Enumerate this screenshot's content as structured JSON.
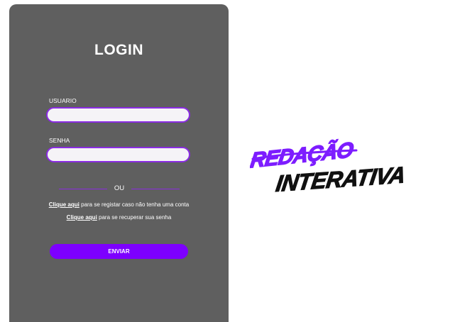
{
  "login": {
    "title": "LOGIN",
    "username_label": "USUARIO",
    "username_value": "",
    "password_label": "SENHA",
    "password_value": "",
    "divider_text": "OU",
    "register_link": "Clique aqui",
    "register_text": " para se registar caso não tenha uma conta",
    "recover_link": "Clique aqui",
    "recover_text": " para se recuperar sua senha",
    "submit_label": "ENVIAR"
  },
  "logo": {
    "line1": "REDAÇÃO",
    "line2": "INTERATIVA",
    "accent_color": "#7d1dff",
    "ink_color": "#111111"
  },
  "colors": {
    "panel": "#5f5f5f",
    "accent": "#7d00ff",
    "input_border": "#8a2be2"
  }
}
